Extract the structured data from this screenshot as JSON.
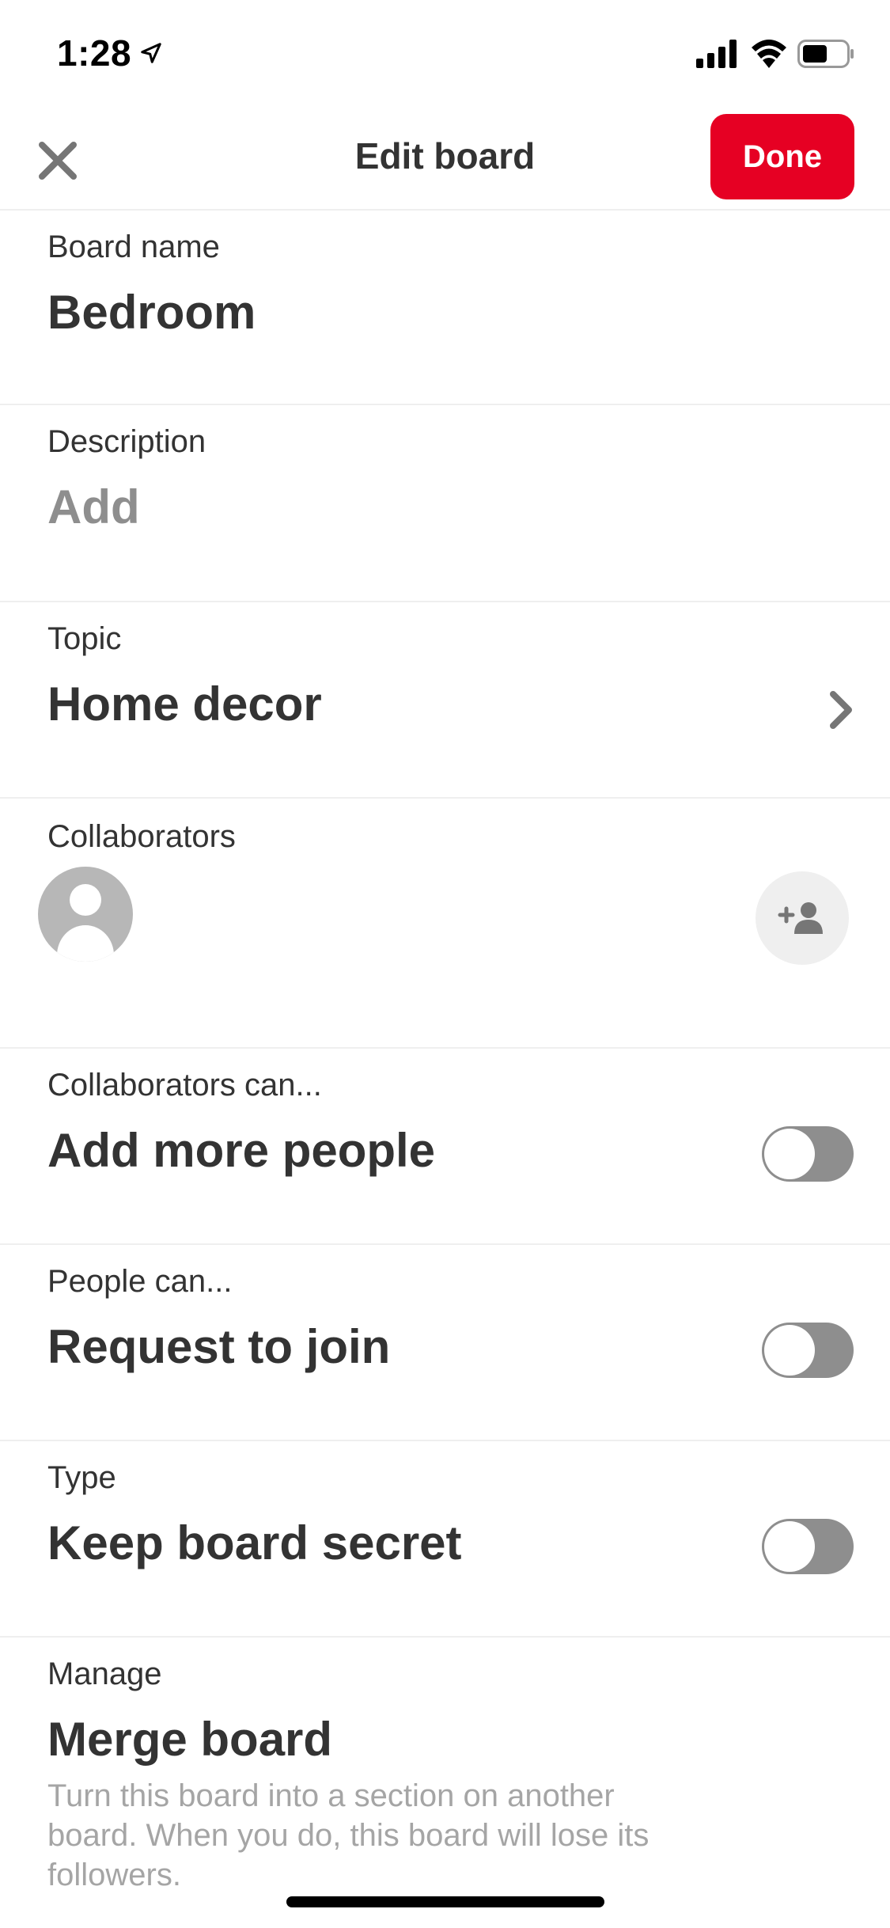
{
  "status_bar": {
    "time": "1:28",
    "icons": [
      "location-arrow-icon",
      "cellular-signal-icon",
      "wifi-icon",
      "battery-icon"
    ]
  },
  "header": {
    "title": "Edit board",
    "close_icon": "close-icon",
    "done_label": "Done"
  },
  "fields": {
    "board_name": {
      "label": "Board name",
      "value": "Bedroom"
    },
    "description": {
      "label": "Description",
      "placeholder": "Add"
    },
    "topic": {
      "label": "Topic",
      "value": "Home decor"
    },
    "collaborators": {
      "label": "Collaborators"
    },
    "collaborators_can": {
      "label": "Collaborators can...",
      "value": "Add more people",
      "enabled": false
    },
    "people_can": {
      "label": "People can...",
      "value": "Request to join",
      "enabled": false
    },
    "type": {
      "label": "Type",
      "value": "Keep board secret",
      "enabled": false
    },
    "manage": {
      "label": "Manage",
      "value": "Merge board",
      "description": "Turn this board into a section on another board. When you do, this board will lose its followers."
    }
  },
  "colors": {
    "brand": "#e60023",
    "text_primary": "#333333",
    "text_placeholder": "#8e8e8e",
    "toggle_off": "#8e8e8e",
    "divider": "#efefef"
  }
}
